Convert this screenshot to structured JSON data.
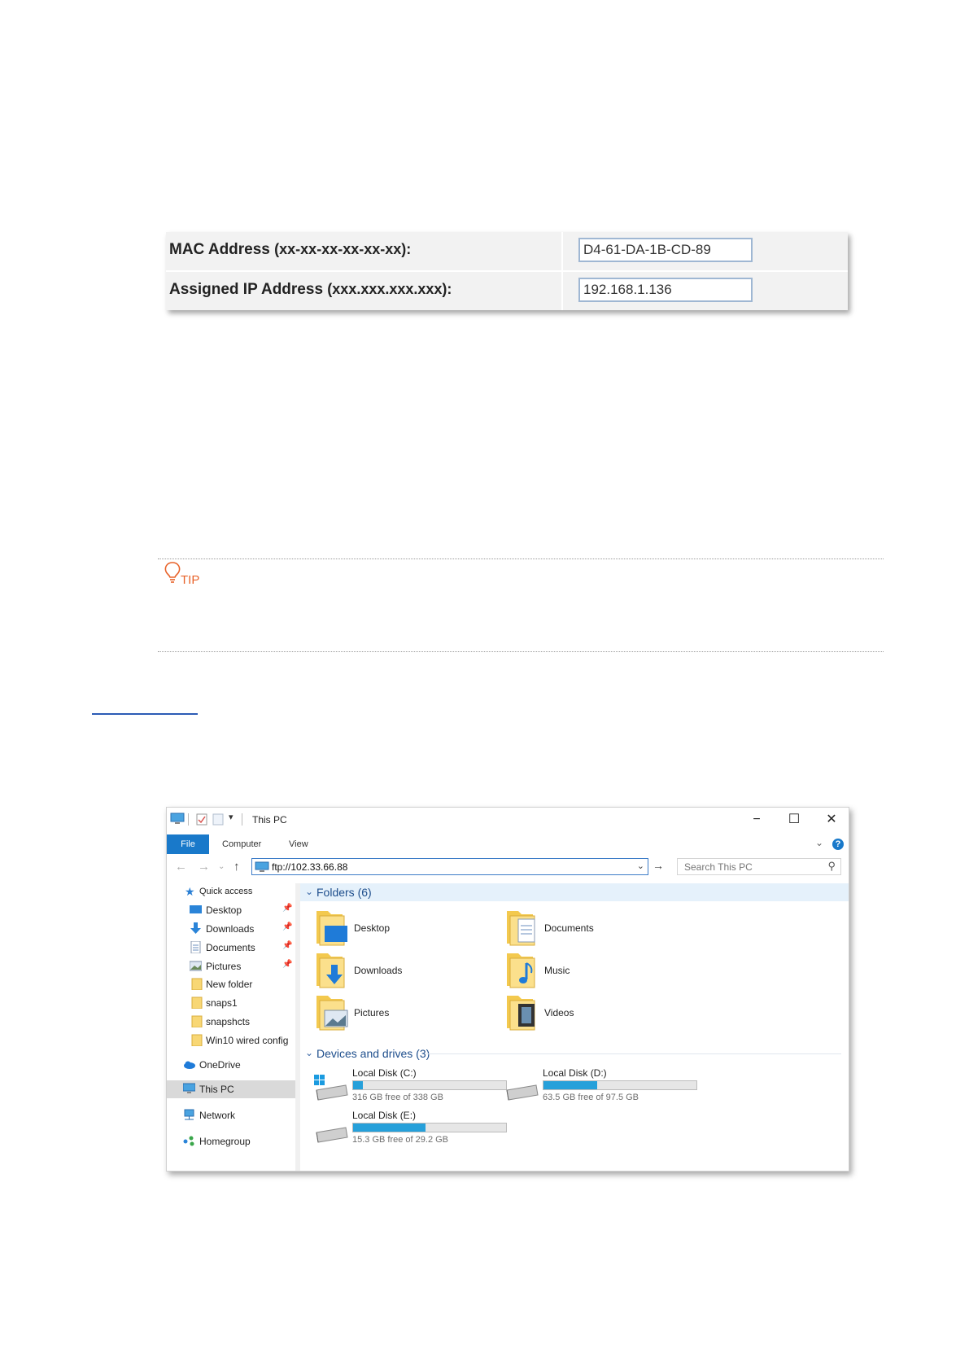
{
  "binding_table": {
    "mac_label": "MAC Address",
    "mac_format": "(xx-xx-xx-xx-xx-xx):",
    "mac_value": "D4-61-DA-1B-CD-89",
    "ip_label": "Assigned IP Address",
    "ip_format": "(xxx.xxx.xxx.xxx):",
    "ip_value": "192.168.1.136"
  },
  "tip": {
    "label": "TIP",
    "icon": "lightbulb-icon",
    "accent_color": "#e8632a"
  },
  "explorer": {
    "title": "This PC",
    "ribbon": {
      "file_tab": "File",
      "tabs": [
        "Computer",
        "View"
      ]
    },
    "address": "ftp://102.33.66.88",
    "search_placeholder": "Search This PC",
    "sidebar": {
      "quick_access": "Quick access",
      "pinned": [
        {
          "label": "Desktop",
          "icon": "desktop-icon"
        },
        {
          "label": "Downloads",
          "icon": "downloads-icon"
        },
        {
          "label": "Documents",
          "icon": "documents-icon"
        },
        {
          "label": "Pictures",
          "icon": "pictures-icon"
        }
      ],
      "folders": [
        "New folder",
        "snaps1",
        "snapshcts",
        "Win10 wired config"
      ],
      "onedrive": "OneDrive",
      "this_pc": "This PC",
      "network": "Network",
      "homegroup": "Homegroup"
    },
    "folders_header": "Folders (6)",
    "folders": [
      {
        "name": "Desktop",
        "icon": "desktop-folder-icon"
      },
      {
        "name": "Documents",
        "icon": "documents-folder-icon"
      },
      {
        "name": "Downloads",
        "icon": "downloads-folder-icon"
      },
      {
        "name": "Music",
        "icon": "music-folder-icon"
      },
      {
        "name": "Pictures",
        "icon": "pictures-folder-icon"
      },
      {
        "name": "Videos",
        "icon": "videos-folder-icon"
      }
    ],
    "drives_header": "Devices and drives (3)",
    "drives": [
      {
        "name": "Local Disk (C:)",
        "free_text": "316 GB free of 338 GB",
        "used_fraction": 0.065
      },
      {
        "name": "Local Disk (D:)",
        "free_text": "63.5 GB free of 97.5 GB",
        "used_fraction": 0.349
      },
      {
        "name": "Local Disk (E:)",
        "free_text": "15.3 GB free of 29.2 GB",
        "used_fraction": 0.476
      }
    ],
    "accent_color": "#1979ca",
    "drive_bar_color": "#26a0da"
  }
}
